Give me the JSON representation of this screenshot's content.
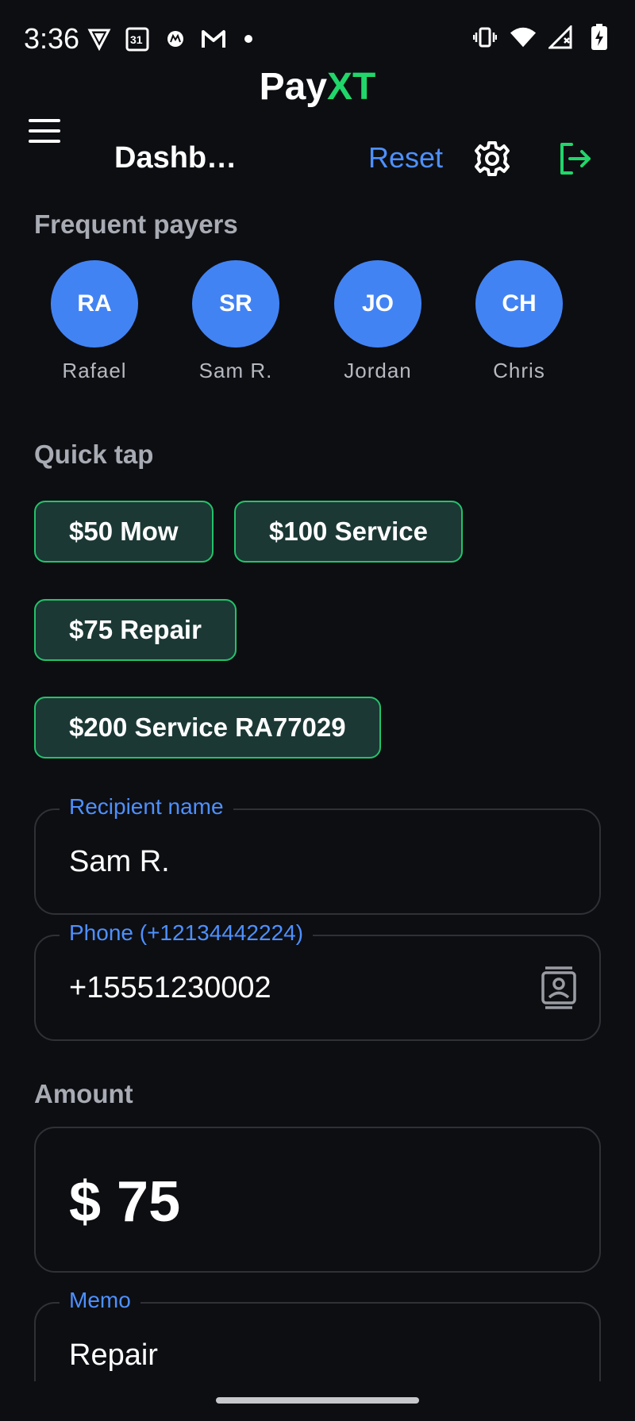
{
  "status_bar": {
    "time": "3:36",
    "left_icons": [
      "vpn-shield-icon",
      "calendar-icon",
      "motorola-icon",
      "gmail-icon",
      "notification-dot"
    ],
    "calendar_day": "31",
    "right_icons": [
      "vibrate-icon",
      "wifi-icon",
      "cell-signal-icon",
      "battery-charging-icon"
    ]
  },
  "app": {
    "name_part1": "Pay",
    "name_part2": "XT",
    "brand_color": "#21d66a",
    "accent_color": "#4d90ff"
  },
  "header": {
    "page_title": "Dashb…",
    "reset_label": "Reset",
    "settings_icon": "gear-icon",
    "logout_icon": "logout-icon"
  },
  "frequent_payers": {
    "label": "Frequent payers",
    "items": [
      {
        "initials": "RA",
        "name": "Rafael"
      },
      {
        "initials": "SR",
        "name": "Sam R."
      },
      {
        "initials": "JO",
        "name": "Jordan"
      },
      {
        "initials": "CH",
        "name": "Chris"
      }
    ]
  },
  "quick_tap": {
    "label": "Quick tap",
    "chips": [
      "$50 Mow",
      "$100 Service",
      "$75 Repair",
      "$200 Service RA77029"
    ]
  },
  "form": {
    "recipient": {
      "label": "Recipient name",
      "value": "Sam R."
    },
    "phone": {
      "label": "Phone (+12134442224)",
      "value": "+15551230002",
      "icon": "contacts-icon"
    },
    "amount_label": "Amount",
    "amount_value": "$ 75",
    "memo": {
      "label": "Memo",
      "value": "Repair"
    }
  }
}
